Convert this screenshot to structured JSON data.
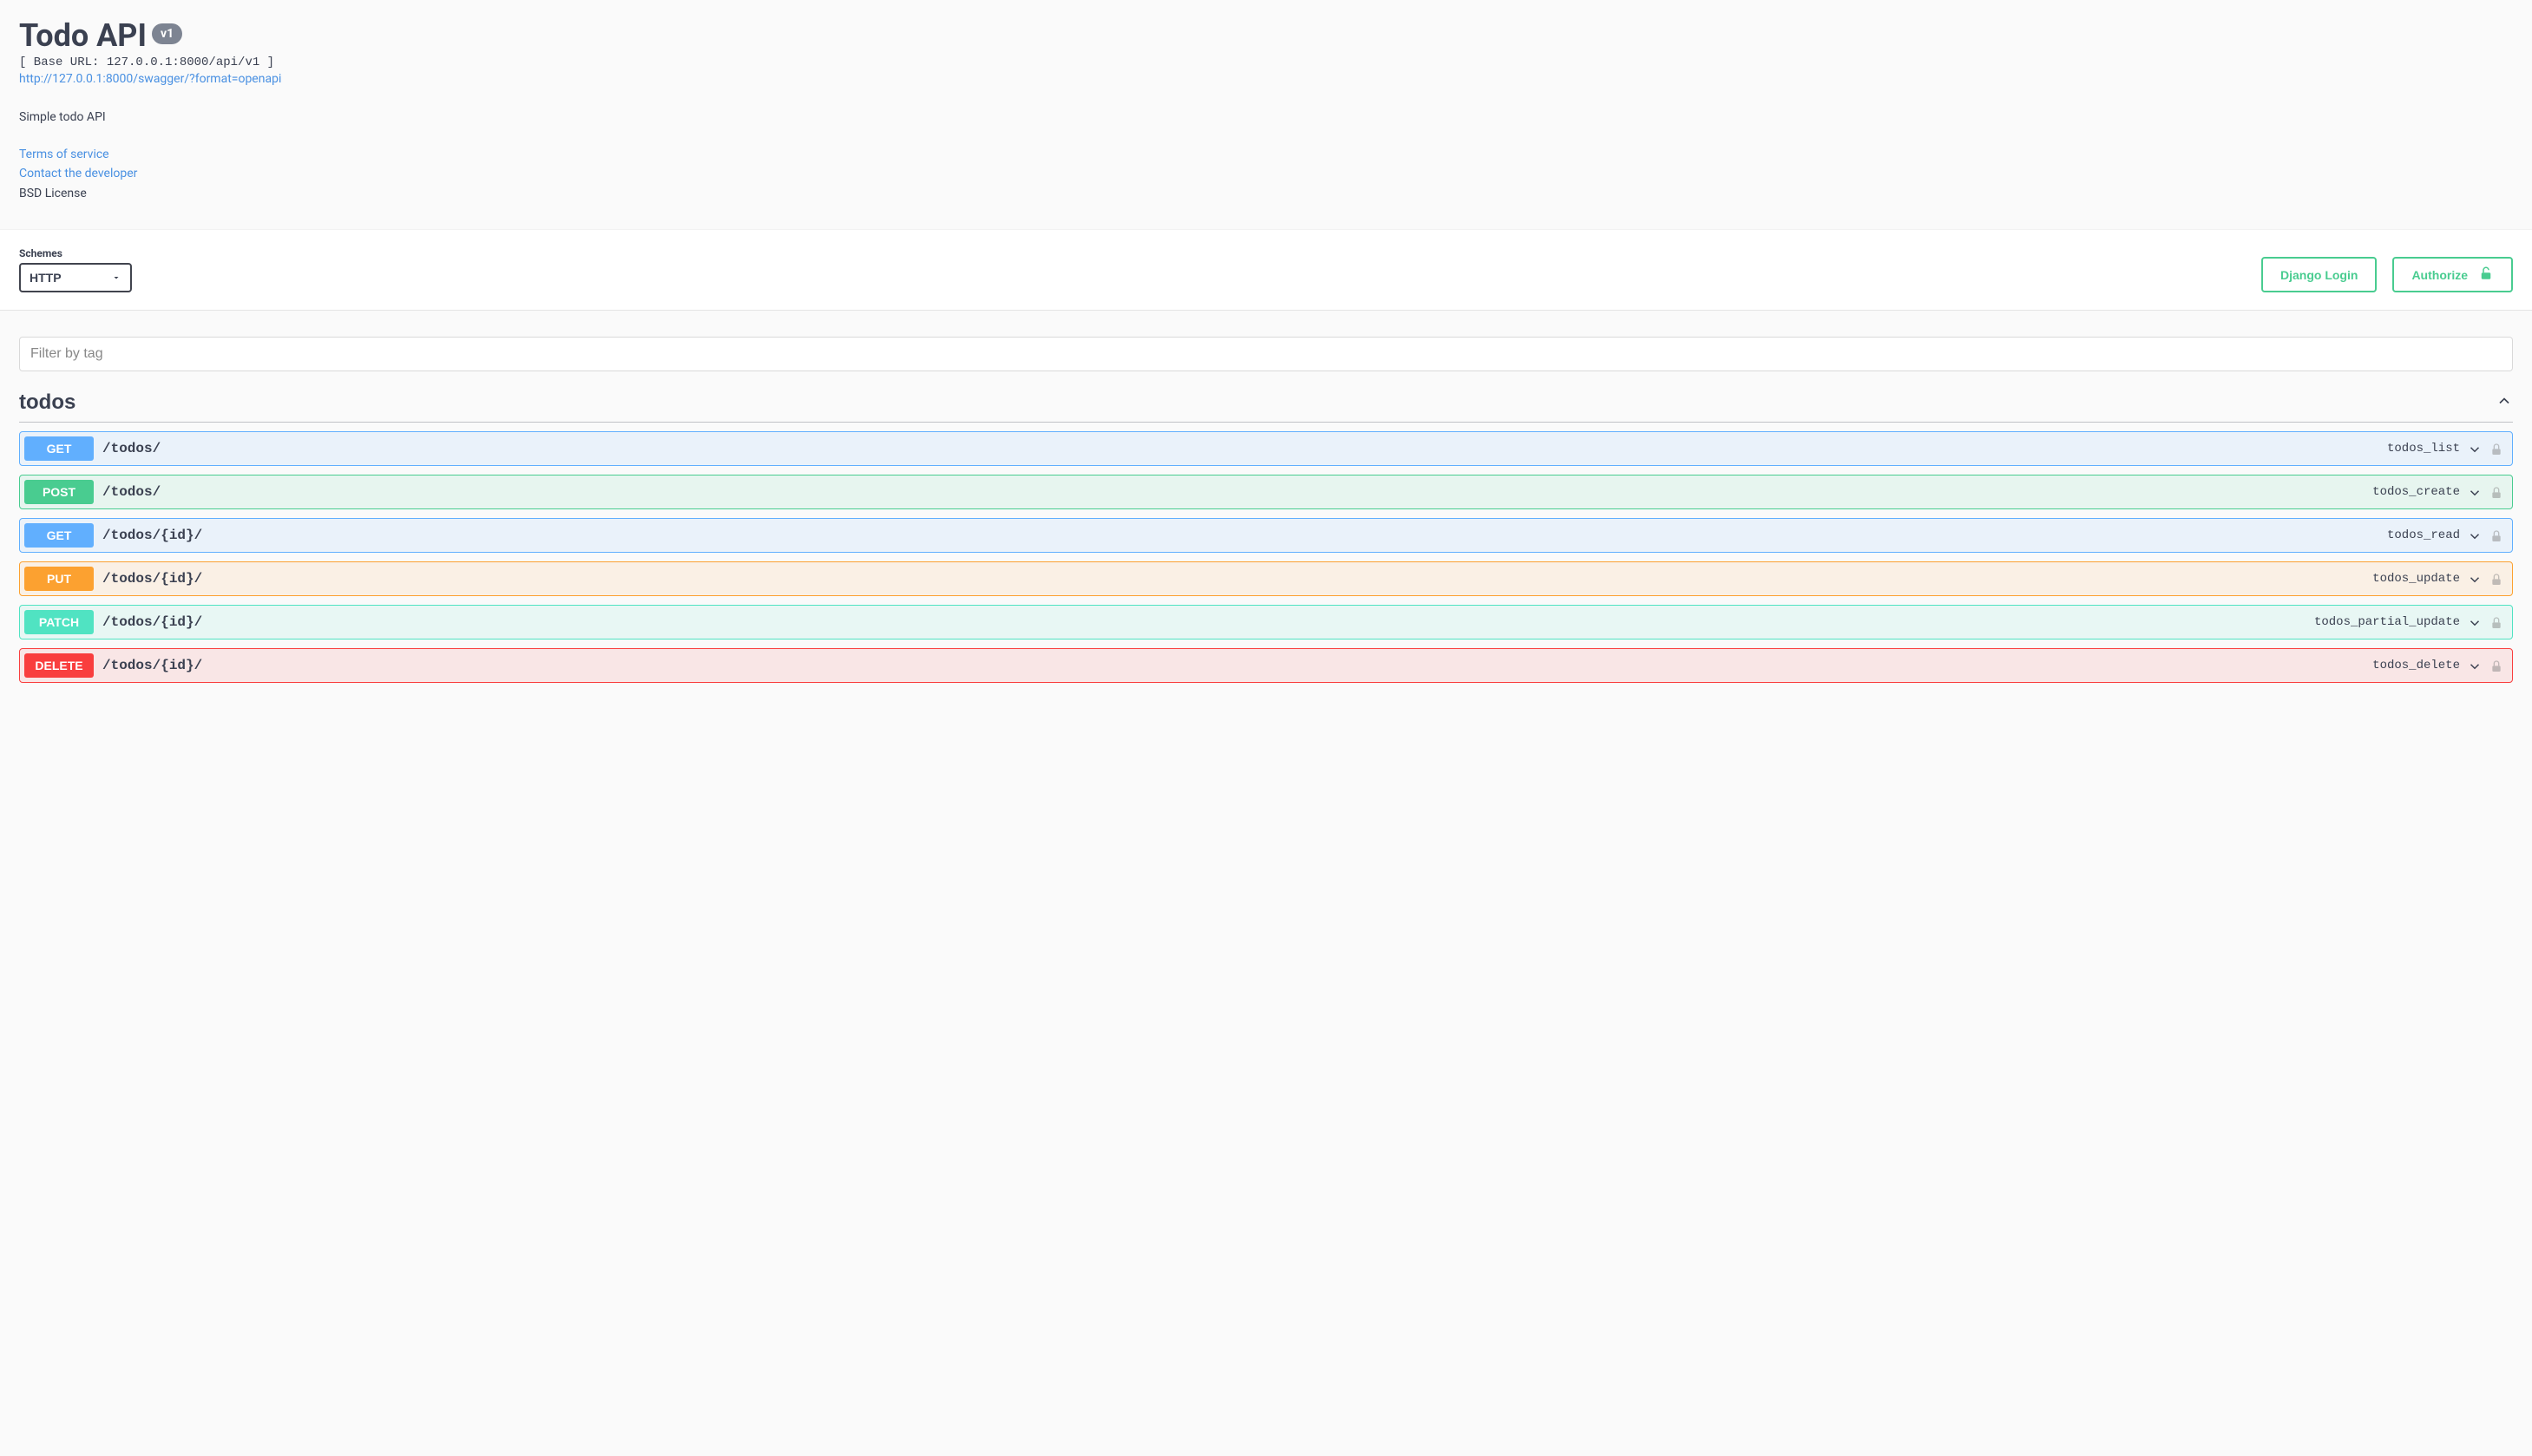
{
  "info": {
    "title": "Todo API",
    "version": "v1",
    "base_url": "[ Base URL: 127.0.0.1:8000/api/v1 ]",
    "spec_url": "http://127.0.0.1:8000/swagger/?format=openapi",
    "description": "Simple todo API",
    "terms_label": "Terms of service",
    "contact_label": "Contact the developer",
    "license": "BSD License"
  },
  "schemes": {
    "label": "Schemes",
    "selected": "HTTP"
  },
  "auth": {
    "login_label": "Django Login",
    "authorize_label": "Authorize"
  },
  "filter": {
    "placeholder": "Filter by tag"
  },
  "tag": {
    "name": "todos"
  },
  "ops": [
    {
      "method": "GET",
      "class": "get",
      "path": "/todos/",
      "id": "todos_list"
    },
    {
      "method": "POST",
      "class": "post",
      "path": "/todos/",
      "id": "todos_create"
    },
    {
      "method": "GET",
      "class": "get",
      "path": "/todos/{id}/",
      "id": "todos_read"
    },
    {
      "method": "PUT",
      "class": "put",
      "path": "/todos/{id}/",
      "id": "todos_update"
    },
    {
      "method": "PATCH",
      "class": "patch",
      "path": "/todos/{id}/",
      "id": "todos_partial_update"
    },
    {
      "method": "DELETE",
      "class": "delete",
      "path": "/todos/{id}/",
      "id": "todos_delete"
    }
  ]
}
